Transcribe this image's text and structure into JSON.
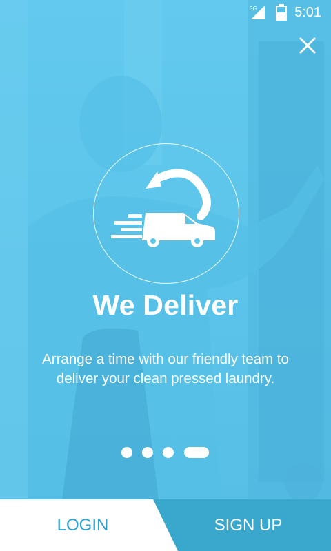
{
  "status_bar": {
    "network": "3G",
    "time": "5:01"
  },
  "close": {
    "icon": "close-icon"
  },
  "hero": {
    "icon": "delivery-van-icon",
    "title": "We Deliver",
    "description": "Arrange a time with our friendly team to deliver your clean pressed laundry."
  },
  "pager": {
    "pages": 4,
    "active_index": 3
  },
  "actions": {
    "login_label": "LOGIN",
    "signup_label": "SIGN UP"
  },
  "colors": {
    "overlay": "#5dc6ec",
    "accent": "#2aa2d2",
    "signup_bg": "#3aa7cd"
  }
}
